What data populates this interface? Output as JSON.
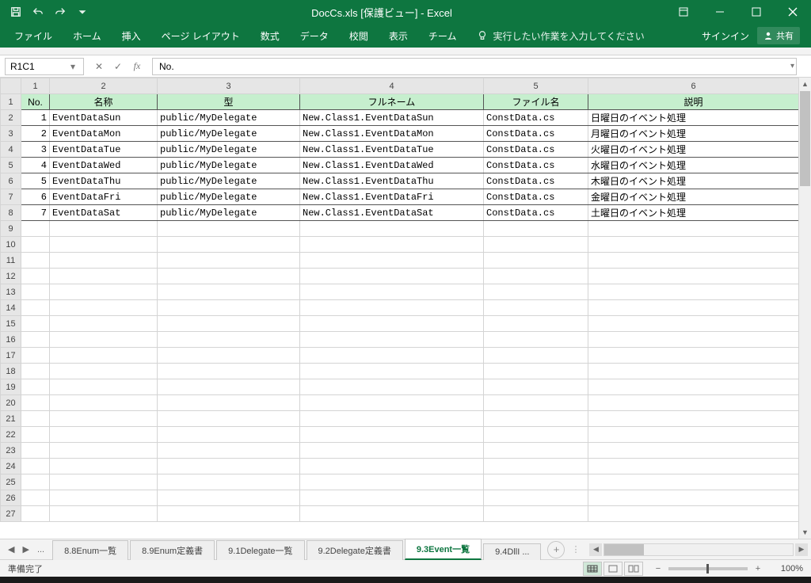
{
  "title": "DocCs.xls  [保護ビュー] - Excel",
  "qat": {
    "save": "save",
    "undo": "undo",
    "redo": "redo",
    "more": "more"
  },
  "ribbon": {
    "tabs": [
      "ファイル",
      "ホーム",
      "挿入",
      "ページ レイアウト",
      "数式",
      "データ",
      "校閲",
      "表示",
      "チーム"
    ],
    "tell_me": "実行したい作業を入力してください",
    "signin": "サインイン",
    "share": "共有"
  },
  "formula": {
    "name_box": "R1C1",
    "value": "No."
  },
  "columns": [
    "1",
    "2",
    "3",
    "4",
    "5",
    "6"
  ],
  "headers": {
    "c1": "No.",
    "c2": "名称",
    "c3": "型",
    "c4": "フルネーム",
    "c5": "ファイル名",
    "c6": "説明"
  },
  "rows": [
    {
      "no": "1",
      "name": "EventDataSun",
      "type": "public/MyDelegate",
      "full": "New.Class1.EventDataSun",
      "file": "ConstData.cs",
      "desc": "日曜日のイベント処理"
    },
    {
      "no": "2",
      "name": "EventDataMon",
      "type": "public/MyDelegate",
      "full": "New.Class1.EventDataMon",
      "file": "ConstData.cs",
      "desc": "月曜日のイベント処理"
    },
    {
      "no": "3",
      "name": "EventDataTue",
      "type": "public/MyDelegate",
      "full": "New.Class1.EventDataTue",
      "file": "ConstData.cs",
      "desc": "火曜日のイベント処理"
    },
    {
      "no": "4",
      "name": "EventDataWed",
      "type": "public/MyDelegate",
      "full": "New.Class1.EventDataWed",
      "file": "ConstData.cs",
      "desc": "水曜日のイベント処理"
    },
    {
      "no": "5",
      "name": "EventDataThu",
      "type": "public/MyDelegate",
      "full": "New.Class1.EventDataThu",
      "file": "ConstData.cs",
      "desc": "木曜日のイベント処理"
    },
    {
      "no": "6",
      "name": "EventDataFri",
      "type": "public/MyDelegate",
      "full": "New.Class1.EventDataFri",
      "file": "ConstData.cs",
      "desc": "金曜日のイベント処理"
    },
    {
      "no": "7",
      "name": "EventDataSat",
      "type": "public/MyDelegate",
      "full": "New.Class1.EventDataSat",
      "file": "ConstData.cs",
      "desc": "土曜日のイベント処理"
    }
  ],
  "row_count_display": 27,
  "sheet_tabs": {
    "ellipsis": "...",
    "items": [
      "8.8Enum一覧",
      "8.9Enum定義書",
      "9.1Delegate一覧",
      "9.2Delegate定義書",
      "9.3Event一覧",
      "9.4DllI ..."
    ],
    "active_index": 4
  },
  "status": {
    "ready": "準備完了",
    "zoom": "100%"
  }
}
